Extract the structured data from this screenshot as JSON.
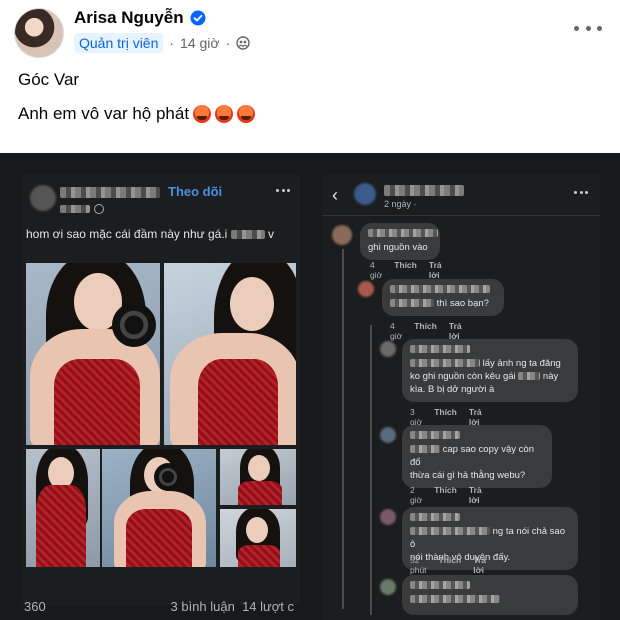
{
  "post": {
    "author": "Arisa Nguyễn",
    "role": "Quản trị viên",
    "time": "14 giờ",
    "separator": "·",
    "line1": "Góc Var",
    "line2": "Anh em vô var hộ phát"
  },
  "screenshot_left": {
    "follow": "Theo dõi",
    "caption_start": "hom ơi sao mặc cái đầm này như gá.i",
    "caption_end": "v",
    "reactions": "360",
    "comments": "3 bình luận",
    "shares": "14 lượt c"
  },
  "screenshot_right": {
    "back": "‹",
    "time": "2 ngày ·",
    "comments": [
      {
        "text": "ghi nguồn vào",
        "time": "4 giờ",
        "like": "Thích",
        "reply": "Trả lời"
      },
      {
        "text": "thì sao bạn?",
        "time": "4 giờ",
        "like": "Thích",
        "reply": "Trả lời"
      },
      {
        "text_a": "lấy ảnh ng ta đăng",
        "text_b": "ko ghi nguồn còn kêu gái",
        "text_c": "này",
        "text_d": "kìa. B bị dở người à",
        "time": "3 giờ",
        "like": "Thích",
        "reply": "Trả lời"
      },
      {
        "text_a": "cap sao copy vậy còn đổ",
        "text_b": "thừa cái gì hả thằng webu?",
        "time": "2 giờ",
        "like": "Thích",
        "reply": "Trả lời"
      },
      {
        "text_a": "ng ta nói chả sao ô",
        "text_b": "nói thành vô duyên đấy.",
        "time": "52 phút",
        "like": "Thích",
        "reply": "Trả lời"
      }
    ]
  },
  "colors": {
    "accent": "#0a66d8",
    "follow": "#4a90e2",
    "dark_bg": "#18191a"
  },
  "icons": [
    "verified-icon",
    "audience-friends-icon",
    "more-icon",
    "angry-emoji-icon",
    "globe-icon",
    "back-icon"
  ]
}
